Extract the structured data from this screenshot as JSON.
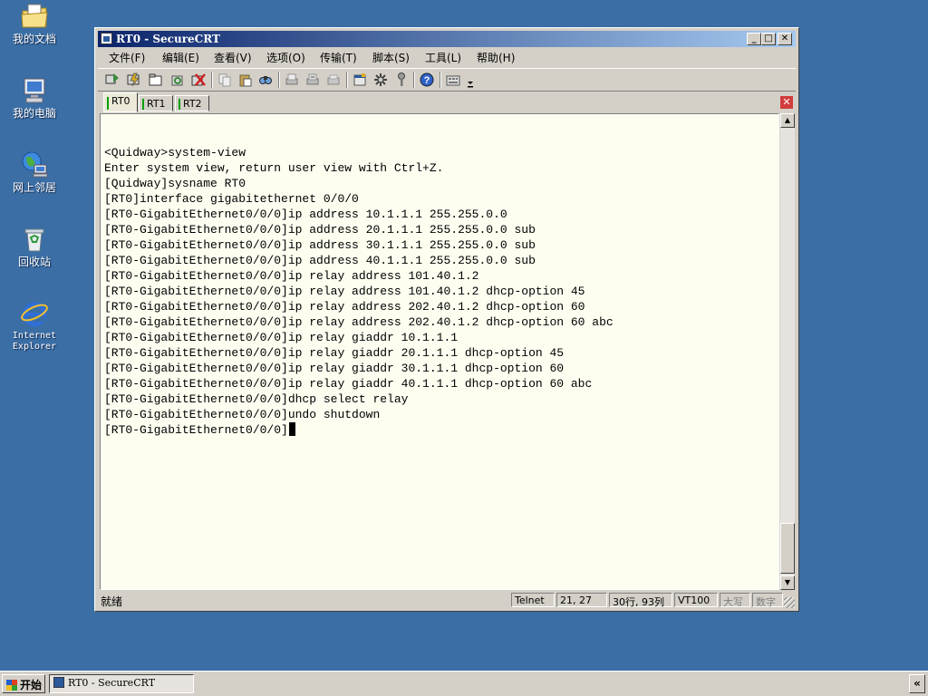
{
  "desktop": {
    "icons": [
      {
        "label": "我的文档",
        "icon": "my-documents-icon"
      },
      {
        "label": "我的电脑",
        "icon": "my-computer-icon"
      },
      {
        "label": "网上邻居",
        "icon": "network-places-icon"
      },
      {
        "label": "回收站",
        "icon": "recycle-bin-icon"
      },
      {
        "label": "Internet Explorer",
        "icon": "internet-explorer-icon"
      }
    ]
  },
  "window": {
    "title": "RT0 - SecureCRT",
    "controls": {
      "minimize": "_",
      "maximize": "□",
      "close": "✕"
    }
  },
  "menu": [
    "文件(F)",
    "编辑(E)",
    "查看(V)",
    "选项(O)",
    "传输(T)",
    "脚本(S)",
    "工具(L)",
    "帮助(H)"
  ],
  "tabs": [
    {
      "label": "RT0",
      "active": true
    },
    {
      "label": "RT1",
      "active": false
    },
    {
      "label": "RT2",
      "active": false
    }
  ],
  "tab_close": "✕",
  "terminal": {
    "lines": [
      "<Quidway>system-view",
      "Enter system view, return user view with Ctrl+Z.",
      "[Quidway]sysname RT0",
      "[RT0]interface gigabitethernet 0/0/0",
      "[RT0-GigabitEthernet0/0/0]ip address 10.1.1.1 255.255.0.0",
      "[RT0-GigabitEthernet0/0/0]ip address 20.1.1.1 255.255.0.0 sub",
      "[RT0-GigabitEthernet0/0/0]ip address 30.1.1.1 255.255.0.0 sub",
      "[RT0-GigabitEthernet0/0/0]ip address 40.1.1.1 255.255.0.0 sub",
      "[RT0-GigabitEthernet0/0/0]ip relay address 101.40.1.2",
      "[RT0-GigabitEthernet0/0/0]ip relay address 101.40.1.2 dhcp-option 45",
      "[RT0-GigabitEthernet0/0/0]ip relay address 202.40.1.2 dhcp-option 60",
      "[RT0-GigabitEthernet0/0/0]ip relay address 202.40.1.2 dhcp-option 60 abc",
      "[RT0-GigabitEthernet0/0/0]ip relay giaddr 10.1.1.1",
      "[RT0-GigabitEthernet0/0/0]ip relay giaddr 20.1.1.1 dhcp-option 45",
      "[RT0-GigabitEthernet0/0/0]ip relay giaddr 30.1.1.1 dhcp-option 60",
      "[RT0-GigabitEthernet0/0/0]ip relay giaddr 40.1.1.1 dhcp-option 60 abc",
      "[RT0-GigabitEthernet0/0/0]dhcp select relay",
      "[RT0-GigabitEthernet0/0/0]undo shutdown",
      "[RT0-GigabitEthernet0/0/0]"
    ]
  },
  "status": {
    "ready": "就绪",
    "protocol": "Telnet",
    "position": "21,  27",
    "size": "30行, 93列",
    "emulation": "VT100",
    "caps": "大写",
    "num": "数字"
  },
  "taskbar": {
    "start_label": "开始",
    "task_label": "RT0 - SecureCRT",
    "tray_toggle": "«"
  }
}
